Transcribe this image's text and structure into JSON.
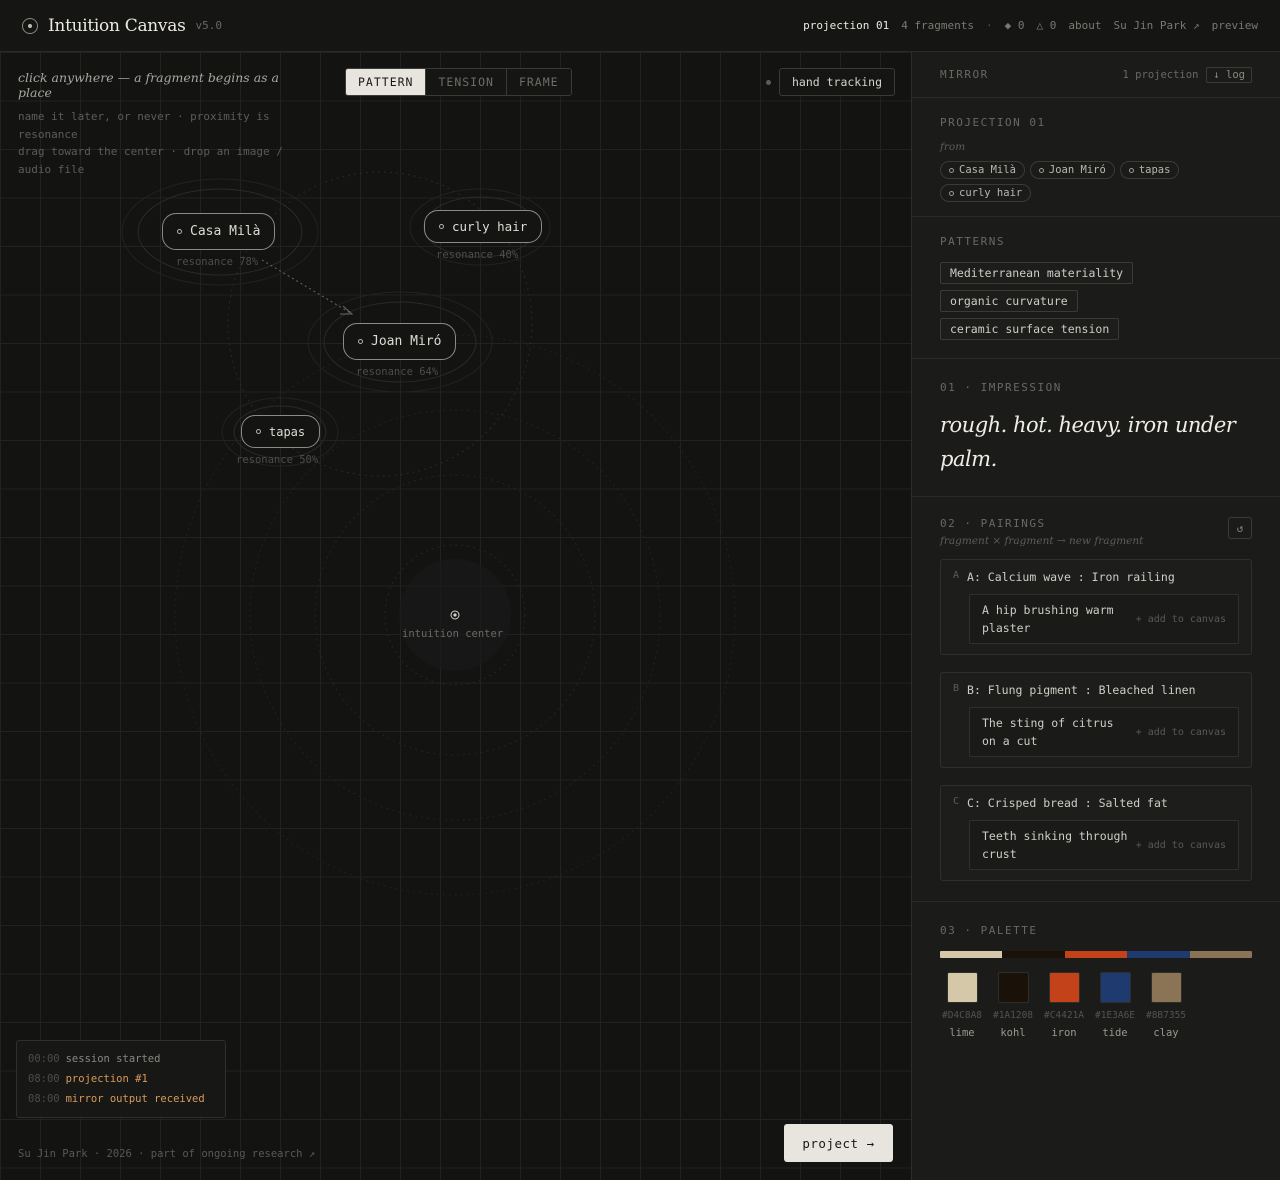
{
  "app": {
    "title": "Intuition Canvas",
    "version": "v5.0"
  },
  "topnav": {
    "projection": "projection 01",
    "fragments": "4 fragments",
    "separator": "·",
    "pattern_count": "◆ 0",
    "tension_count": "△ 0",
    "about": "about",
    "author": "Su Jin Park ↗",
    "preview": "preview"
  },
  "canvas": {
    "hint_title": "click anywhere — a fragment begins as a place",
    "hint_lines": [
      "name it later, or never · proximity is",
      "resonance",
      "drag toward the center · drop an image /",
      "audio file"
    ],
    "modes": [
      "PATTERN",
      "TENSION",
      "FRAME"
    ],
    "active_mode": "PATTERN",
    "hand_tracking": "hand tracking",
    "fragments": [
      {
        "label": "Casa Milà",
        "resonance": "resonance 78%"
      },
      {
        "label": "curly hair",
        "resonance": "resonance 40%"
      },
      {
        "label": "Joan Miró",
        "resonance": "resonance 64%"
      },
      {
        "label": "tapas",
        "resonance": "resonance 50%"
      }
    ],
    "center_label": "intuition center",
    "log": [
      {
        "time": "00:00",
        "msg": "session started",
        "highlight": false
      },
      {
        "time": "08:00",
        "msg": "projection #1",
        "highlight": true
      },
      {
        "time": "08:00",
        "msg": "mirror output received",
        "highlight": true
      }
    ],
    "footer": "Su Jin Park · 2026 · part of ongoing research ↗",
    "project_button": "project →"
  },
  "mirror": {
    "title": "MIRROR",
    "count": "1 projection",
    "log_button": "↓ log",
    "projection": {
      "title": "PROJECTION 01",
      "from_label": "from",
      "sources": [
        "Casa Milà",
        "Joan Miró",
        "tapas",
        "curly hair"
      ]
    },
    "patterns": {
      "title": "PATTERNS",
      "items": [
        "Mediterranean materiality",
        "organic curvature",
        "ceramic surface tension"
      ]
    },
    "impression": {
      "title": "01 · IMPRESSION",
      "text": "rough. hot. heavy. iron under palm."
    },
    "pairings": {
      "title": "02 · PAIRINGS",
      "subtitle": "fragment × fragment → new fragment",
      "refresh": "↺",
      "items": [
        {
          "letter": "A",
          "title": "A: Calcium wave : Iron railing",
          "text": "A hip brushing warm plaster",
          "action": "+ add to canvas"
        },
        {
          "letter": "B",
          "title": "B: Flung pigment : Bleached linen",
          "text": "The sting of citrus on a cut",
          "action": "+ add to canvas"
        },
        {
          "letter": "C",
          "title": "C: Crisped bread : Salted fat",
          "text": "Teeth sinking through crust",
          "action": "+ add to canvas"
        }
      ]
    },
    "palette": {
      "title": "03 · PALETTE",
      "colors": [
        {
          "hex": "#D4C8A8",
          "name": "lime"
        },
        {
          "hex": "#1A1208",
          "name": "kohl"
        },
        {
          "hex": "#C4421A",
          "name": "iron"
        },
        {
          "hex": "#1E3A6E",
          "name": "tide"
        },
        {
          "hex": "#8B7355",
          "name": "clay"
        }
      ]
    }
  }
}
